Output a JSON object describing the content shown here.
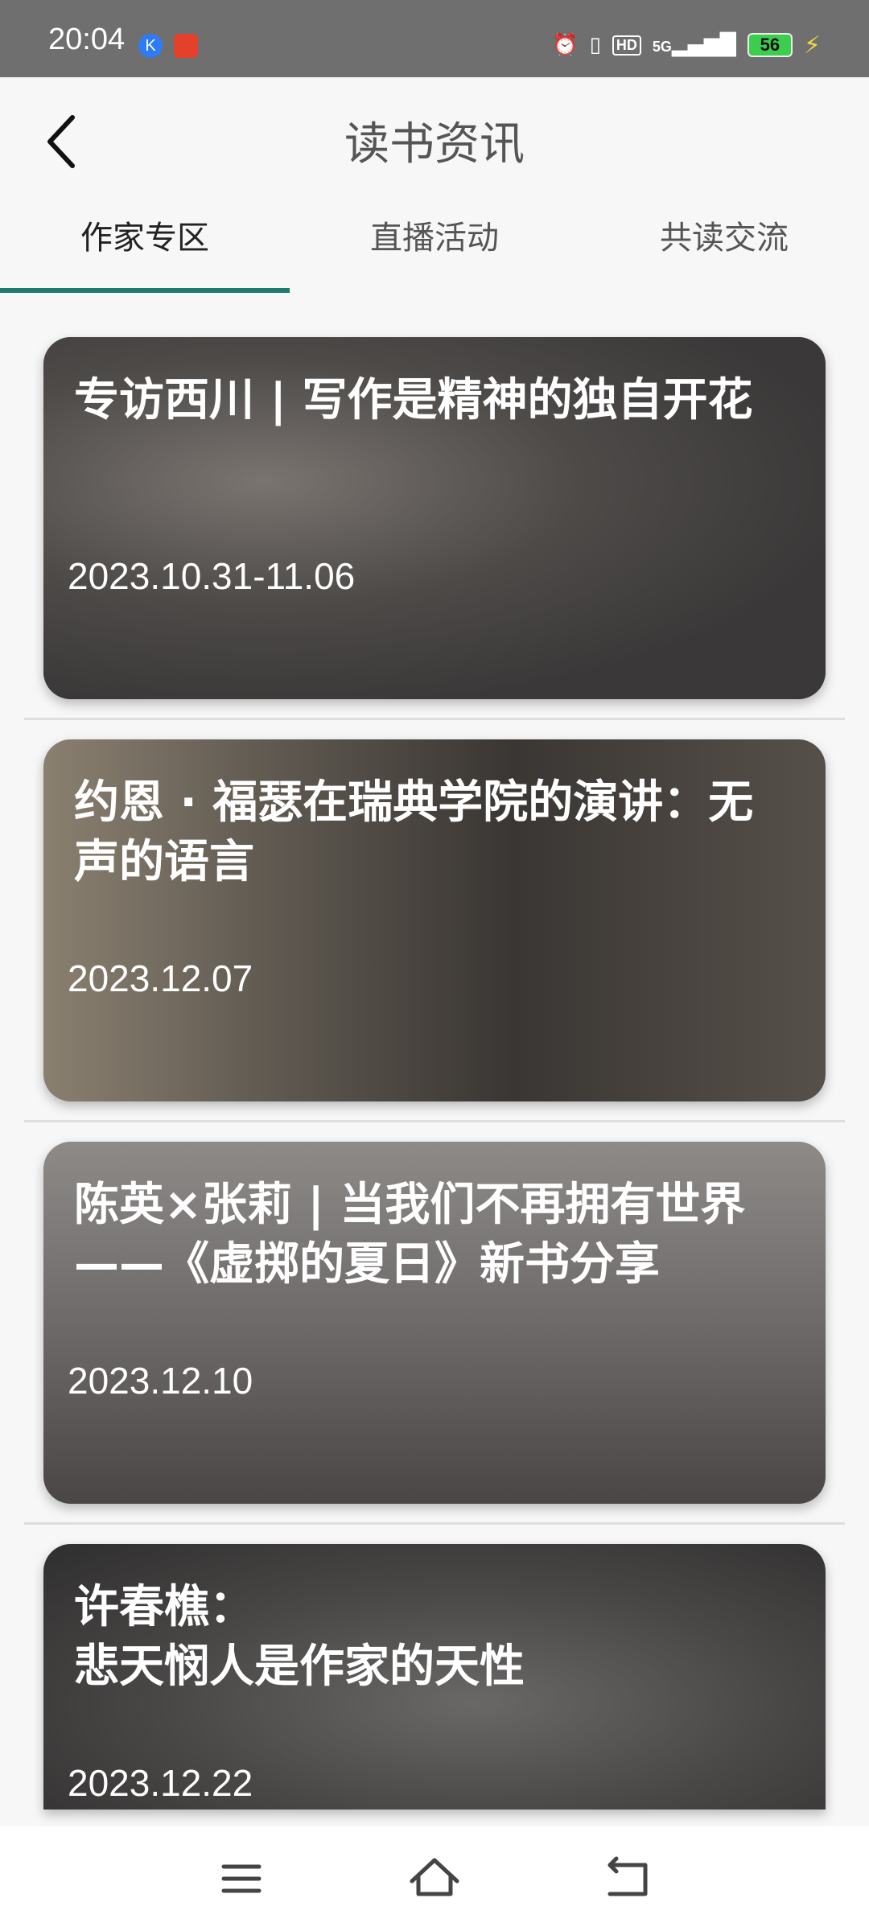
{
  "status_bar": {
    "time": "20:04",
    "k_icon": "K",
    "hd": "HD",
    "network": "5G",
    "battery": "56"
  },
  "header": {
    "title": "读书资讯"
  },
  "tabs": [
    {
      "label": "作家专区",
      "active": true
    },
    {
      "label": "直播活动",
      "active": false
    },
    {
      "label": "共读交流",
      "active": false
    }
  ],
  "articles": [
    {
      "title": "专访西川 | 写作是精神的独自开花",
      "date": "2023.10.31-11.06"
    },
    {
      "title": "约恩 · 福瑟在瑞典学院的演讲：无声的语言",
      "date": "2023.12.07"
    },
    {
      "title": "陈英×张莉 | 当我们不再拥有世界——《虚掷的夏日》新书分享",
      "date": "2023.12.10"
    },
    {
      "title": "许春樵：\n悲天悯人是作家的天性",
      "date": "2023.12.22"
    }
  ],
  "colors": {
    "accent": "#1e7c6c",
    "status_bar": "#6f6f6f"
  },
  "icons": {
    "back": "chevron-left-icon",
    "menu": "menu-icon",
    "home": "home-icon",
    "return": "back-nav-icon"
  }
}
